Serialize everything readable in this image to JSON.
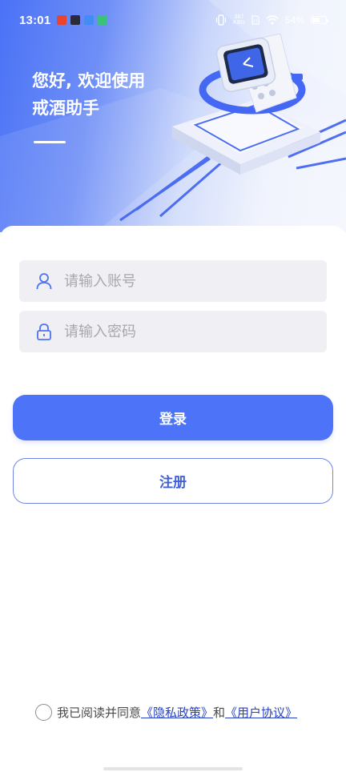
{
  "status_bar": {
    "time": "13:01",
    "net_speed_value": "387",
    "net_speed_unit": "KB/s",
    "battery": "54%",
    "battery_level": 0.54,
    "apps": [
      {
        "name": "app-red-icon",
        "color": "#e8452f"
      },
      {
        "name": "app-dark-icon",
        "color": "#2a2a3a"
      },
      {
        "name": "app-blue-icon",
        "color": "#3f8df5"
      },
      {
        "name": "app-green-icon",
        "color": "#3ac27a"
      }
    ]
  },
  "header": {
    "greeting_line1": "您好, 欢迎使用",
    "greeting_line2": "戒酒助手"
  },
  "form": {
    "account_placeholder": "请输入账号",
    "password_placeholder": "请输入密码",
    "account_icon": "user-icon",
    "password_icon": "lock-icon"
  },
  "buttons": {
    "login": "登录",
    "register": "注册"
  },
  "agreement": {
    "prefix": "我已阅读并同意",
    "privacy_link": "《隐私政策》",
    "conjunction": "和",
    "terms_link": "《用户协议》",
    "checked": false
  },
  "colors": {
    "primary": "#4d73f8",
    "outline": "#6f86e6",
    "link": "#2740c4",
    "field_bg": "#f0f0f4"
  }
}
